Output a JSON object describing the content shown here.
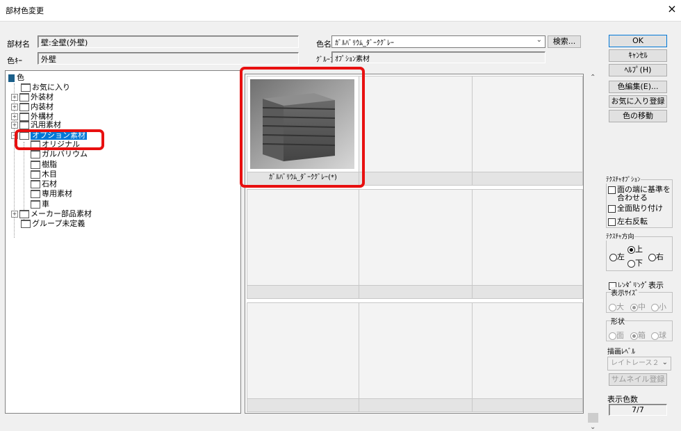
{
  "window": {
    "title": "部材色変更",
    "close_glyph": "×"
  },
  "top_fields": {
    "part_name_label": "部材名",
    "part_name_value": "壁:全壁(外壁)",
    "color_key_label": "色ｷｰ",
    "color_key_value": "外壁",
    "color_name_label": "色名",
    "color_name_value": "ｶﾞﾙﾊﾞﾘｳﾑ_ﾀﾞｰｸｸﾞﾚｰ",
    "search_button": "検索...",
    "group_label": "ｸﾞﾙｰﾌﾟ",
    "group_value": "ｵﾌﾟｼｮﾝ素材"
  },
  "buttons": {
    "ok": "OK",
    "cancel": "ｷｬﾝｾﾙ",
    "help": "ﾍﾙﾌﾟ(H)",
    "edit_color": "色編集(E)...",
    "favorite_register": "お気に入り登録",
    "move_color": "色の移動"
  },
  "tree": {
    "root": "色",
    "items": [
      {
        "label": "お気に入り"
      },
      {
        "label": "外装材"
      },
      {
        "label": "内装材"
      },
      {
        "label": "外構材"
      },
      {
        "label": "汎用素材"
      },
      {
        "label": "オプション素材"
      },
      {
        "label": "オリジナル"
      },
      {
        "label": "ガルバリウム"
      },
      {
        "label": "樹脂"
      },
      {
        "label": "木目"
      },
      {
        "label": "石材"
      },
      {
        "label": "専用素材"
      },
      {
        "label": "車"
      },
      {
        "label": "メーカー部品素材"
      },
      {
        "label": "グループ未定義"
      }
    ]
  },
  "grid": {
    "selected_item_label": "ｶﾞﾙﾊﾞﾘｳﾑ_ﾀﾞｰｸｸﾞﾚｰ(*)"
  },
  "texture_options": {
    "group_label": "ﾃｸｽﾁｬｵﾌﾟｼｮﾝ",
    "align_edge_line1": "面の端に基準を",
    "align_edge_line2": "合わせる",
    "full_paste": "全面貼り付け",
    "flip_lr": "左右反転"
  },
  "texture_direction": {
    "group_label": "ﾃｸｽﾁｬ方向",
    "left": "左",
    "up": "上",
    "right": "右",
    "down": "下",
    "selected": "上"
  },
  "rendering": {
    "toggle_label": "ﾚﾝﾀﾞﾘﾝｸﾞ表示",
    "size_label": "表示ｻｲｽﾞ",
    "size_large": "大",
    "size_medium": "中",
    "size_small": "小",
    "shape_label": "形状",
    "shape_plane": "面",
    "shape_box": "箱",
    "shape_sphere": "球",
    "level_label": "描画ﾚﾍﾞﾙ",
    "level_value": "レイトレース２",
    "thumbnail_button": "サムネイル登録"
  },
  "count": {
    "label": "表示色数",
    "value": "7/7"
  },
  "colors": {
    "highlight_red": "#e81010",
    "selection_blue": "#0078d7"
  }
}
